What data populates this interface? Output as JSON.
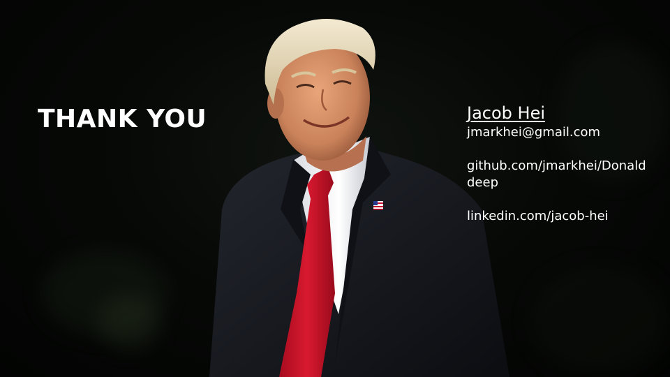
{
  "slide": {
    "heading": "THANK YOU",
    "contact": {
      "name": "Jacob Hei",
      "email": "jmarkhei@gmail.com",
      "github": "github.com/jmarkhei/Donalddeep",
      "linkedin": "linkedin.com/jacob-hei"
    },
    "colors": {
      "background": "#050705",
      "text": "#ffffff",
      "tie": "#c8102e",
      "suit": "#14161c"
    }
  }
}
